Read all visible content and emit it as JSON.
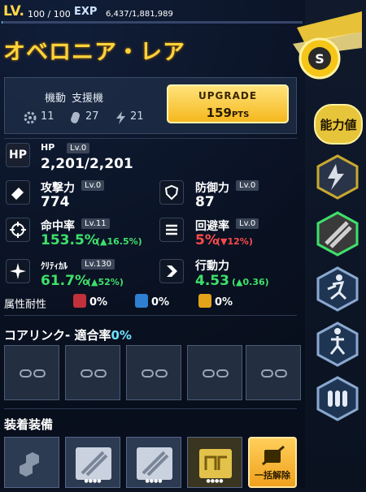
{
  "top": {
    "lv_label": "LV.",
    "lv_value": "100 / 100",
    "exp_label": "EXP",
    "exp_value": "6,437/1,881,989",
    "exp_progress": 0.0034
  },
  "unit_name": "オベロニア・レア",
  "unit_info": {
    "type": "機動",
    "role": "支援機",
    "stat_gear": "11",
    "stat_ammo": "27",
    "stat_bolt": "21"
  },
  "upgrade": {
    "label": "UPGRADE",
    "points": "159",
    "unit": "PTS"
  },
  "hp": {
    "badge": "HP",
    "label": "HP",
    "level": "Lv.0",
    "value": "2,201/2,201"
  },
  "stats": {
    "atk": {
      "label": "攻撃力",
      "level": "Lv.0",
      "value": "774"
    },
    "def": {
      "label": "防御力",
      "level": "Lv.0",
      "value": "87"
    },
    "hit": {
      "label": "命中率",
      "level": "Lv.11",
      "value": "153.5%",
      "delta": "(▲16.5%)"
    },
    "eva": {
      "label": "回避率",
      "level": "Lv.0",
      "value": "5%",
      "delta": "(▼12%)"
    },
    "crit": {
      "label": "ｸﾘﾃｨｶﾙ",
      "level": "Lv.130",
      "value": "61.7%",
      "delta": "(▲52%)"
    },
    "act": {
      "label": "行動力",
      "level": "",
      "value": "4.53",
      "delta": "(▲0.36)"
    }
  },
  "resist": {
    "label": "属性耐性",
    "fire": "0%",
    "ice": "0%",
    "thunder": "0%"
  },
  "core": {
    "label": "コアリンク- 適合率",
    "rate": "0%"
  },
  "equip": {
    "label": "装着装備",
    "release": "一括解除"
  },
  "side": {
    "ability_label": "能力値"
  },
  "colors": {
    "accent": "#ffd43a",
    "green": "#3fe06b",
    "red": "#ff4a4a",
    "cyan": "#6de1ff"
  }
}
